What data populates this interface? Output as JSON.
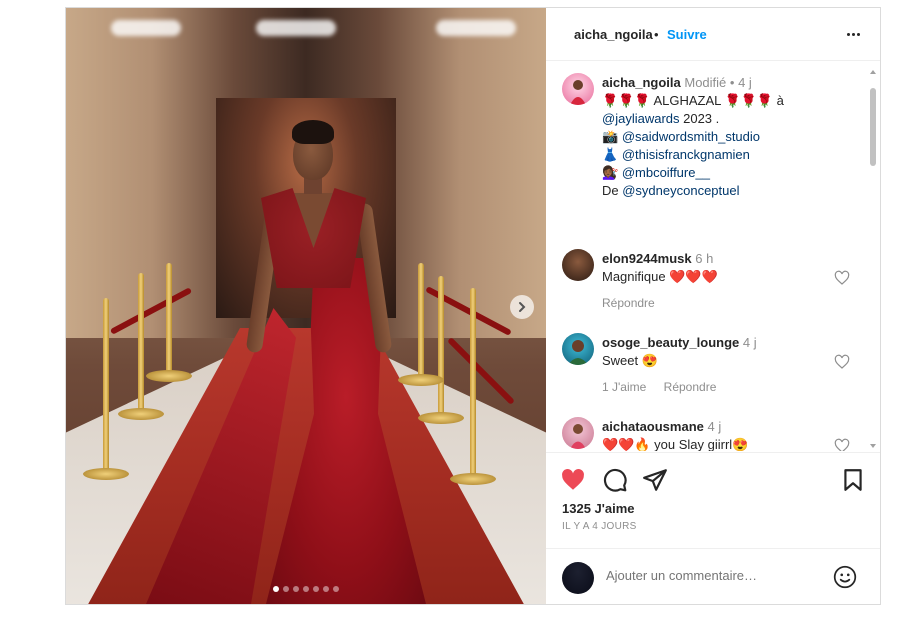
{
  "post": {
    "username": "aicha_ngoila",
    "separator": "•",
    "follow_label": "Suivre",
    "image_index": 1,
    "image_count": 7
  },
  "caption": {
    "username": "aicha_ngoila",
    "edited": "Modifié",
    "time": "• 4 j",
    "line1": "🌹🌹🌹 ALGHAZAL 🌹🌹🌹 à",
    "line2_mention": "@jayliawards",
    "line2_rest": " 2023 .",
    "line3_icon": "📸",
    "line3_mention": "@saidwordsmith_studio",
    "line4_icon": "👗",
    "line4_mention": "@thisisfranckgnamien",
    "line5_icon": "💇🏾‍♀️",
    "line5_mention": "@mbcoiffure__",
    "line6_prefix": "De ",
    "line6_mention": "@sydneyconceptuel"
  },
  "comments": [
    {
      "username": "elon9244musk",
      "time": "6 h",
      "text": "Magnifique ❤️❤️❤️",
      "reply_label": "Répondre",
      "likes_label": ""
    },
    {
      "username": "osoge_beauty_lounge",
      "time": "4 j",
      "text": "Sweet 😍",
      "likes_label": "1 J'aime",
      "reply_label": "Répondre"
    },
    {
      "username": "aichataousmane",
      "time": "4 j",
      "text": "❤️❤️🔥 you Slay giirrl😍",
      "reply_label": "",
      "likes_label": ""
    }
  ],
  "footer": {
    "likes": "1325 J'aime",
    "date": "IL Y A 4 JOURS",
    "add_comment_placeholder": "Ajouter un commentaire…"
  },
  "icons": {
    "like": "heart-icon",
    "comment": "comment-icon",
    "share": "paper-plane-icon",
    "save": "bookmark-icon",
    "emoji": "smiley-icon",
    "more": "more-dots-icon",
    "next": "chevron-right-icon"
  },
  "colors": {
    "like_red": "#ed4956",
    "link_blue": "#0095f6",
    "mention_blue": "#00376b",
    "text": "#262626",
    "muted": "#8e8e8e"
  }
}
